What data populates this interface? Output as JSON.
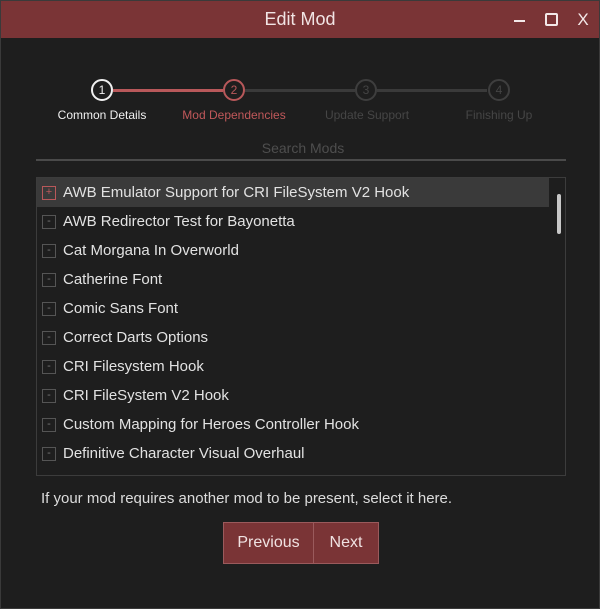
{
  "window": {
    "title": "Edit Mod",
    "minimize_icon": "minimize-icon",
    "maximize_icon": "maximize-icon",
    "close_glyph": "X"
  },
  "stepper": {
    "steps": [
      {
        "number": "1",
        "label": "Common Details",
        "state": "completed"
      },
      {
        "number": "2",
        "label": "Mod Dependencies",
        "state": "current"
      },
      {
        "number": "3",
        "label": "Update Support",
        "state": "pending"
      },
      {
        "number": "4",
        "label": "Finishing Up",
        "state": "pending"
      }
    ]
  },
  "search": {
    "placeholder": "Search Mods",
    "value": ""
  },
  "mods": [
    {
      "label": "AWB Emulator Support for CRI FileSystem V2 Hook",
      "mark": "+",
      "selected": true
    },
    {
      "label": "AWB Redirector Test for Bayonetta",
      "mark": "-",
      "selected": false
    },
    {
      "label": "Cat Morgana In Overworld",
      "mark": "-",
      "selected": false
    },
    {
      "label": "Catherine Font",
      "mark": "-",
      "selected": false
    },
    {
      "label": "Comic Sans Font",
      "mark": "-",
      "selected": false
    },
    {
      "label": "Correct Darts Options",
      "mark": "-",
      "selected": false
    },
    {
      "label": "CRI Filesystem Hook",
      "mark": "-",
      "selected": false
    },
    {
      "label": "CRI FileSystem V2 Hook",
      "mark": "-",
      "selected": false
    },
    {
      "label": "Custom Mapping for Heroes Controller Hook",
      "mark": "-",
      "selected": false
    },
    {
      "label": "Definitive Character Visual Overhaul",
      "mark": "-",
      "selected": false
    }
  ],
  "hint": "If your mod requires another mod to be present, select it here.",
  "buttons": {
    "previous": "Previous",
    "next": "Next"
  },
  "colors": {
    "accent": "#7a3436",
    "accent_light": "#c0585a",
    "background": "#1e1e1e"
  }
}
